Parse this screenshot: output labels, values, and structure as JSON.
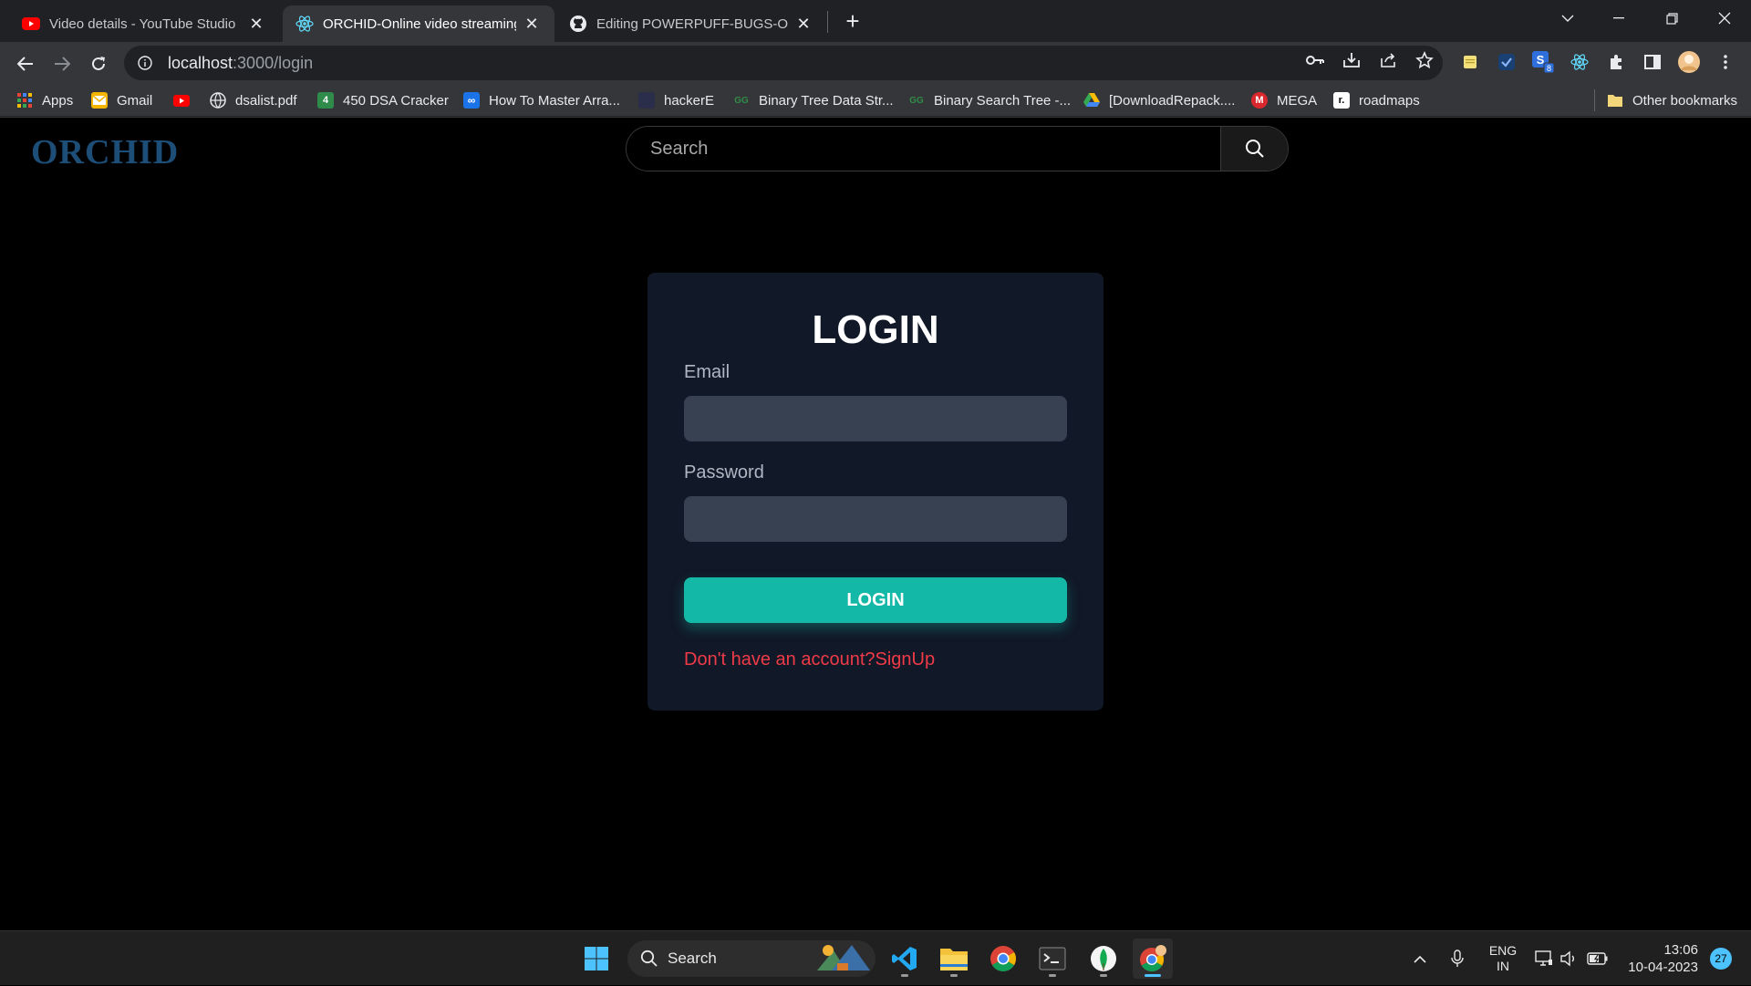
{
  "browser": {
    "tabs": [
      {
        "title": "Video details - YouTube Studio",
        "icon": "youtube-icon"
      },
      {
        "title": "ORCHID-Online video streaming",
        "icon": "react-icon"
      },
      {
        "title": "Editing POWERPUFF-BUGS-ORCHID",
        "icon": "github-icon"
      }
    ],
    "url_host": "localhost",
    "url_path": ":3000/login"
  },
  "bookmarks": [
    {
      "label": "Apps",
      "icon": "apps-grid-icon"
    },
    {
      "label": "Gmail",
      "icon": "gmail-icon"
    },
    {
      "label": "",
      "icon": "youtube-icon"
    },
    {
      "label": "dsalist.pdf",
      "icon": "globe-icon"
    },
    {
      "label": "450 DSA Cracker",
      "icon": "number-four-icon"
    },
    {
      "label": "How To Master Arra...",
      "icon": "infinity-icon"
    },
    {
      "label": "hackerE",
      "icon": "hackerearth-icon"
    },
    {
      "label": "Binary Tree Data Str...",
      "icon": "geeksforgeeks-icon"
    },
    {
      "label": "Binary Search Tree -...",
      "icon": "geeksforgeeks-icon"
    },
    {
      "label": "[DownloadRepack....",
      "icon": "google-drive-icon"
    },
    {
      "label": "MEGA",
      "icon": "mega-icon"
    },
    {
      "label": "roadmaps",
      "icon": "roadmap-icon"
    },
    {
      "label": "Other bookmarks",
      "icon": "folder-icon"
    }
  ],
  "app": {
    "logo": "ORCHID",
    "search_placeholder": "Search"
  },
  "login": {
    "title": "LOGIN",
    "email_label": "Email",
    "password_label": "Password",
    "button_label": "LOGIN",
    "signup_text": "Don't have an account?SignUp"
  },
  "taskbar": {
    "search_label": "Search",
    "language_top": "ENG",
    "language_bottom": "IN",
    "time": "13:06",
    "date": "10-04-2023",
    "notification_count": "27"
  },
  "colors": {
    "accent": "#14b8a6",
    "signup_link": "#ef3b47",
    "logo": "#1d4e78",
    "card_bg": "#111827",
    "input_bg": "#374151"
  }
}
